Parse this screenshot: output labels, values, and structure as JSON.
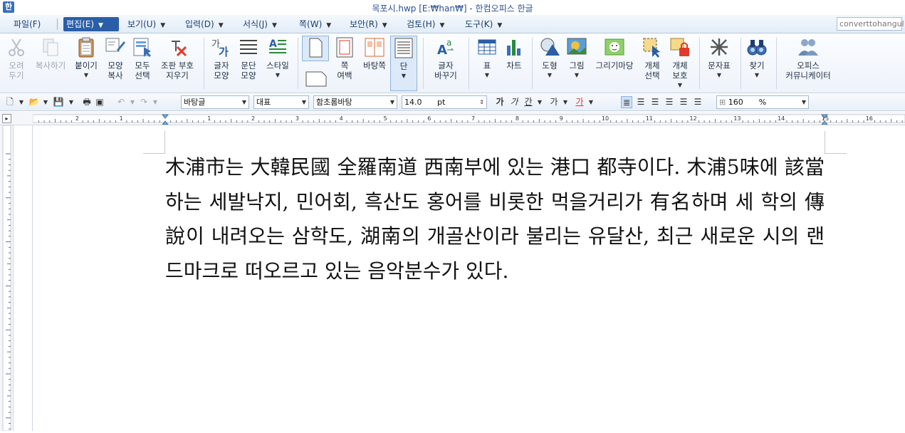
{
  "window": {
    "title": "목포시.hwp [E:₩han₩] - 한컴오피스 한글"
  },
  "menubar": {
    "items": [
      {
        "label": "파일(F)"
      },
      {
        "label": "편집(E)"
      },
      {
        "label": "보기(U)"
      },
      {
        "label": "입력(D)"
      },
      {
        "label": "서식(J)"
      },
      {
        "label": "쪽(W)"
      },
      {
        "label": "보안(R)"
      },
      {
        "label": "검토(H)"
      },
      {
        "label": "도구(K)"
      }
    ],
    "search_value": "converttohangul"
  },
  "ribbon": {
    "cut": "오려\n두기",
    "copy": "복사하기",
    "paste": "붙이기",
    "format_copy": "모양\n복사",
    "select_all": "모두\n선택",
    "clear_format": "조판 부호\n지우기",
    "char_shape": "글자\n모양",
    "para_shape": "문단\n모양",
    "style": "스타일",
    "page_margin": "쪽\n여백",
    "master_page": "바탕쪽",
    "column": "단",
    "char_replace": "글자\n바꾸기",
    "table": "표",
    "chart": "차트",
    "shape": "도형",
    "picture": "그림",
    "drawing": "그리기마당",
    "obj_select": "개체\n선택",
    "obj_protect": "개체\n보호",
    "symbol": "문자표",
    "find": "찾기",
    "community": "오피스\n커뮤니케이터"
  },
  "formatbar": {
    "style": "바탕글",
    "lang": "대표",
    "font": "함초롬바탕",
    "size": "14.0",
    "size_unit": "pt",
    "zoom": "160",
    "zoom_unit": "%"
  },
  "ruler": {
    "labels": [
      "2",
      "1",
      "1",
      "2",
      "3",
      "4",
      "5",
      "6",
      "7",
      "8",
      "9",
      "10",
      "11",
      "12",
      "13",
      "14",
      "15",
      "16"
    ]
  },
  "document": {
    "text": "木浦市는 大韓民國 全羅南道 西南부에 있는 港口 都寺이다. 木浦5味에 該當하는 세발낙지, 민어회, 흑산도 홍어를 비롯한 먹을거리가 有名하며 세 학의 傳說이 내려오는 삼학도, 湖南의 개골산이라 불리는 유달산, 최근 새로운 시의 랜드마크로 떠오르고 있는 음악분수가 있다."
  }
}
